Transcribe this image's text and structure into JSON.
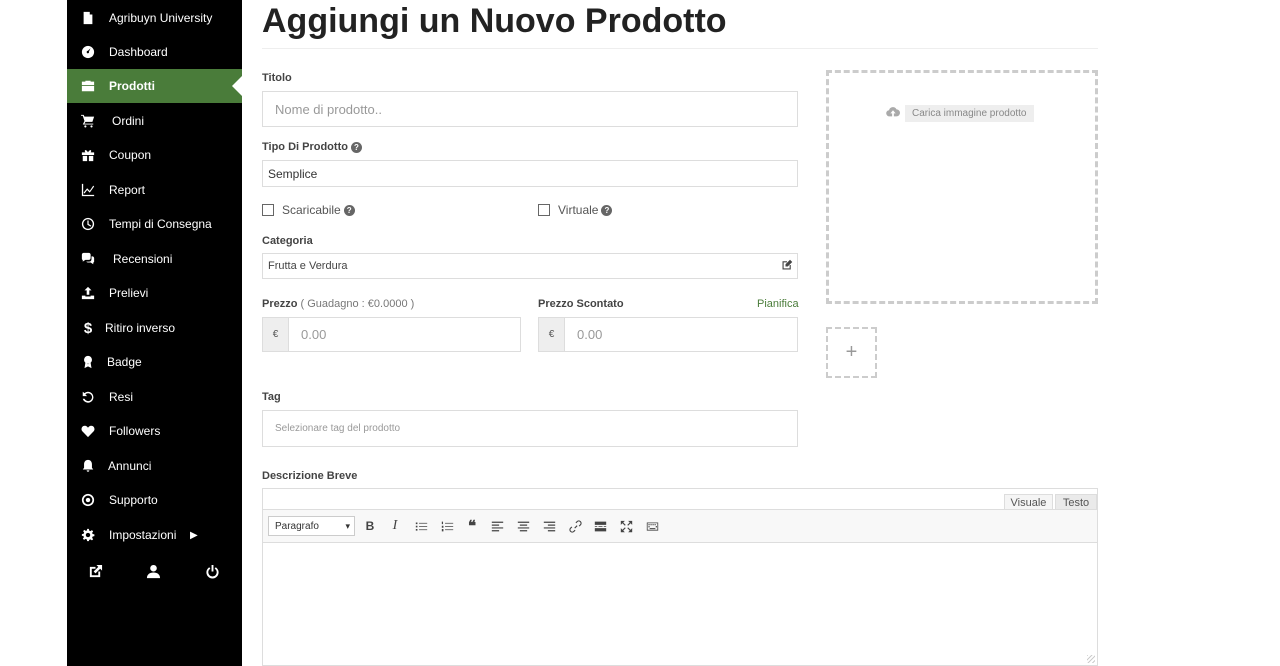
{
  "sidebar": {
    "items": [
      {
        "label": "Agribuyn University",
        "icon": "pdf-file-icon"
      },
      {
        "label": "Dashboard",
        "icon": "tachometer-icon"
      },
      {
        "label": "Prodotti",
        "icon": "briefcase-icon",
        "active": true
      },
      {
        "label": "Ordini",
        "icon": "shopping-cart-icon"
      },
      {
        "label": "Coupon",
        "icon": "gift-icon"
      },
      {
        "label": "Report",
        "icon": "line-chart-icon"
      },
      {
        "label": "Tempi di Consegna",
        "icon": "clock-icon"
      },
      {
        "label": "Recensioni",
        "icon": "comments-icon"
      },
      {
        "label": "Prelievi",
        "icon": "upload-icon"
      },
      {
        "label": "Ritiro inverso",
        "icon": "dollar-icon"
      },
      {
        "label": "Badge",
        "icon": "award-icon"
      },
      {
        "label": "Resi",
        "icon": "undo-icon"
      },
      {
        "label": "Followers",
        "icon": "heart-icon"
      },
      {
        "label": "Annunci",
        "icon": "bell-icon"
      },
      {
        "label": "Supporto",
        "icon": "lifebuoy-icon"
      },
      {
        "label": "Impostazioni",
        "icon": "gear-icon"
      }
    ],
    "active_color": "#4a7c3a"
  },
  "page": {
    "title": "Aggiungi un Nuovo Prodotto"
  },
  "form": {
    "title_label": "Titolo",
    "title_placeholder": "Nome di prodotto..",
    "type_label": "Tipo Di Prodotto",
    "type_value": "Semplice",
    "downloadable_label": "Scaricabile",
    "virtual_label": "Virtuale",
    "category_label": "Categoria",
    "category_value": "Frutta e Verdura",
    "price_label": "Prezzo",
    "price_earning": "( Guadagno : €0.0000 )",
    "price_placeholder": "0.00",
    "currency": "€",
    "sale_price_label": "Prezzo Scontato",
    "schedule_link": "Pianifica",
    "sale_price_placeholder": "0.00",
    "tag_label": "Tag",
    "tag_placeholder": "Selezionare tag del prodotto",
    "short_desc_label": "Descrizione Breve"
  },
  "image": {
    "upload_label": "Carica immagine prodotto",
    "add_gallery": "+"
  },
  "editor": {
    "tab_visual": "Visuale",
    "tab_text": "Testo",
    "format_value": "Paragrafo",
    "bold": "B",
    "italic": "I",
    "quote": "❝"
  }
}
